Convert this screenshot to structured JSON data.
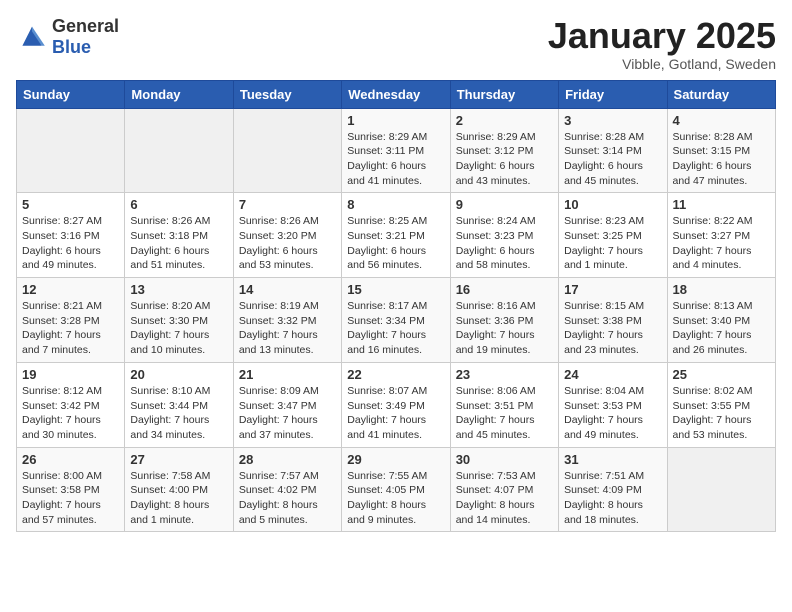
{
  "logo": {
    "general": "General",
    "blue": "Blue"
  },
  "title": "January 2025",
  "subtitle": "Vibble, Gotland, Sweden",
  "days_of_week": [
    "Sunday",
    "Monday",
    "Tuesday",
    "Wednesday",
    "Thursday",
    "Friday",
    "Saturday"
  ],
  "weeks": [
    [
      {
        "day": "",
        "info": ""
      },
      {
        "day": "",
        "info": ""
      },
      {
        "day": "",
        "info": ""
      },
      {
        "day": "1",
        "info": "Sunrise: 8:29 AM\nSunset: 3:11 PM\nDaylight: 6 hours\nand 41 minutes."
      },
      {
        "day": "2",
        "info": "Sunrise: 8:29 AM\nSunset: 3:12 PM\nDaylight: 6 hours\nand 43 minutes."
      },
      {
        "day": "3",
        "info": "Sunrise: 8:28 AM\nSunset: 3:14 PM\nDaylight: 6 hours\nand 45 minutes."
      },
      {
        "day": "4",
        "info": "Sunrise: 8:28 AM\nSunset: 3:15 PM\nDaylight: 6 hours\nand 47 minutes."
      }
    ],
    [
      {
        "day": "5",
        "info": "Sunrise: 8:27 AM\nSunset: 3:16 PM\nDaylight: 6 hours\nand 49 minutes."
      },
      {
        "day": "6",
        "info": "Sunrise: 8:26 AM\nSunset: 3:18 PM\nDaylight: 6 hours\nand 51 minutes."
      },
      {
        "day": "7",
        "info": "Sunrise: 8:26 AM\nSunset: 3:20 PM\nDaylight: 6 hours\nand 53 minutes."
      },
      {
        "day": "8",
        "info": "Sunrise: 8:25 AM\nSunset: 3:21 PM\nDaylight: 6 hours\nand 56 minutes."
      },
      {
        "day": "9",
        "info": "Sunrise: 8:24 AM\nSunset: 3:23 PM\nDaylight: 6 hours\nand 58 minutes."
      },
      {
        "day": "10",
        "info": "Sunrise: 8:23 AM\nSunset: 3:25 PM\nDaylight: 7 hours\nand 1 minute."
      },
      {
        "day": "11",
        "info": "Sunrise: 8:22 AM\nSunset: 3:27 PM\nDaylight: 7 hours\nand 4 minutes."
      }
    ],
    [
      {
        "day": "12",
        "info": "Sunrise: 8:21 AM\nSunset: 3:28 PM\nDaylight: 7 hours\nand 7 minutes."
      },
      {
        "day": "13",
        "info": "Sunrise: 8:20 AM\nSunset: 3:30 PM\nDaylight: 7 hours\nand 10 minutes."
      },
      {
        "day": "14",
        "info": "Sunrise: 8:19 AM\nSunset: 3:32 PM\nDaylight: 7 hours\nand 13 minutes."
      },
      {
        "day": "15",
        "info": "Sunrise: 8:17 AM\nSunset: 3:34 PM\nDaylight: 7 hours\nand 16 minutes."
      },
      {
        "day": "16",
        "info": "Sunrise: 8:16 AM\nSunset: 3:36 PM\nDaylight: 7 hours\nand 19 minutes."
      },
      {
        "day": "17",
        "info": "Sunrise: 8:15 AM\nSunset: 3:38 PM\nDaylight: 7 hours\nand 23 minutes."
      },
      {
        "day": "18",
        "info": "Sunrise: 8:13 AM\nSunset: 3:40 PM\nDaylight: 7 hours\nand 26 minutes."
      }
    ],
    [
      {
        "day": "19",
        "info": "Sunrise: 8:12 AM\nSunset: 3:42 PM\nDaylight: 7 hours\nand 30 minutes."
      },
      {
        "day": "20",
        "info": "Sunrise: 8:10 AM\nSunset: 3:44 PM\nDaylight: 7 hours\nand 34 minutes."
      },
      {
        "day": "21",
        "info": "Sunrise: 8:09 AM\nSunset: 3:47 PM\nDaylight: 7 hours\nand 37 minutes."
      },
      {
        "day": "22",
        "info": "Sunrise: 8:07 AM\nSunset: 3:49 PM\nDaylight: 7 hours\nand 41 minutes."
      },
      {
        "day": "23",
        "info": "Sunrise: 8:06 AM\nSunset: 3:51 PM\nDaylight: 7 hours\nand 45 minutes."
      },
      {
        "day": "24",
        "info": "Sunrise: 8:04 AM\nSunset: 3:53 PM\nDaylight: 7 hours\nand 49 minutes."
      },
      {
        "day": "25",
        "info": "Sunrise: 8:02 AM\nSunset: 3:55 PM\nDaylight: 7 hours\nand 53 minutes."
      }
    ],
    [
      {
        "day": "26",
        "info": "Sunrise: 8:00 AM\nSunset: 3:58 PM\nDaylight: 7 hours\nand 57 minutes."
      },
      {
        "day": "27",
        "info": "Sunrise: 7:58 AM\nSunset: 4:00 PM\nDaylight: 8 hours\nand 1 minute."
      },
      {
        "day": "28",
        "info": "Sunrise: 7:57 AM\nSunset: 4:02 PM\nDaylight: 8 hours\nand 5 minutes."
      },
      {
        "day": "29",
        "info": "Sunrise: 7:55 AM\nSunset: 4:05 PM\nDaylight: 8 hours\nand 9 minutes."
      },
      {
        "day": "30",
        "info": "Sunrise: 7:53 AM\nSunset: 4:07 PM\nDaylight: 8 hours\nand 14 minutes."
      },
      {
        "day": "31",
        "info": "Sunrise: 7:51 AM\nSunset: 4:09 PM\nDaylight: 8 hours\nand 18 minutes."
      },
      {
        "day": "",
        "info": ""
      }
    ]
  ]
}
